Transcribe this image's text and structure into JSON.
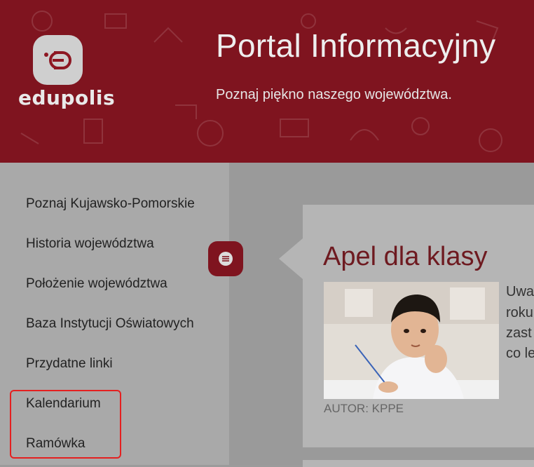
{
  "header": {
    "logo_text": "edupolis",
    "title": "Portal Informacyjny",
    "subtitle": "Poznaj piękno naszego województwa."
  },
  "sidebar": {
    "items": [
      {
        "label": "Poznaj Kujawsko-Pomorskie"
      },
      {
        "label": "Historia województwa"
      },
      {
        "label": "Położenie województwa"
      },
      {
        "label": "Baza Instytucji Oświatowych"
      },
      {
        "label": "Przydatne linki"
      },
      {
        "label": "Kalendarium"
      },
      {
        "label": "Ramówka"
      }
    ]
  },
  "article": {
    "title": "Apel dla klasy",
    "author": "AUTOR: KPPE",
    "excerpt_lines": [
      "Uwa",
      "roku",
      "zast",
      "co le"
    ]
  },
  "icons": {
    "logo": "edupolis-logo-icon",
    "chat": "chat-bubble-icon"
  },
  "colors": {
    "brand": "#7f141f",
    "highlight": "#e42020",
    "title": "#6e1a20"
  }
}
